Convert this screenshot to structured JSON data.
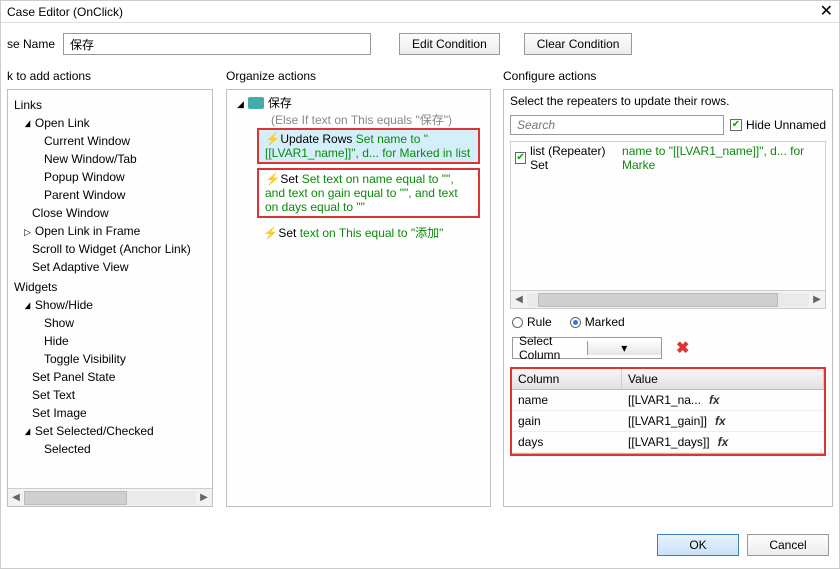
{
  "titlebar": {
    "title": "Case Editor (OnClick)"
  },
  "nameRow": {
    "label": "se Name",
    "value": "保存",
    "editCondition": "Edit Condition",
    "clearCondition": "Clear Condition"
  },
  "columns": {
    "leftHeader": "k to add actions",
    "midHeader": "Organize actions",
    "rightHeader": "Configure actions"
  },
  "leftTree": {
    "links": "Links",
    "openLink": "Open Link",
    "currentWindow": "Current Window",
    "newWindowTab": "New Window/Tab",
    "popupWindow": "Popup Window",
    "parentWindow": "Parent Window",
    "closeWindow": "Close Window",
    "openLinkInFrame": "Open Link in Frame",
    "scrollToWidget": "Scroll to Widget (Anchor Link)",
    "setAdaptiveView": "Set Adaptive View",
    "widgets": "Widgets",
    "showHide": "Show/Hide",
    "show": "Show",
    "hide": "Hide",
    "toggleVisibility": "Toggle Visibility",
    "setPanelState": "Set Panel State",
    "setText": "Set Text",
    "setImage": "Set Image",
    "setSelectedChecked": "Set Selected/Checked",
    "selected": "Selected"
  },
  "organize": {
    "root": "保存",
    "condition": "(Else If text on This equals \"保存\")",
    "a1_pre": "Update Rows ",
    "a1_green": "Set name to \"[[LVAR1_name]]\", d... for Marked in list",
    "a2": "Set text on name equal to \"\", and text on gain equal to \"\", and text on days equal to \"\"",
    "a3_pre": "Set ",
    "a3_green": "text on This equal to \"添加\""
  },
  "configure": {
    "selectRepeaters": "Select the repeaters to update their rows.",
    "searchPlaceholder": "Search",
    "hideUnnamed": "Hide Unnamed",
    "repRowPrefix": "list (Repeater) Set ",
    "repRowGreen": "name to \"[[LVAR1_name]]\", d... for Marke",
    "rule": "Rule",
    "marked": "Marked",
    "selectColumn": "Select Column",
    "thColumn": "Column",
    "thValue": "Value",
    "rows": [
      {
        "col": "name",
        "val": "[[LVAR1_na..."
      },
      {
        "col": "gain",
        "val": "[[LVAR1_gain]]"
      },
      {
        "col": "days",
        "val": "[[LVAR1_days]]"
      }
    ]
  },
  "buttons": {
    "ok": "OK",
    "cancel": "Cancel"
  }
}
